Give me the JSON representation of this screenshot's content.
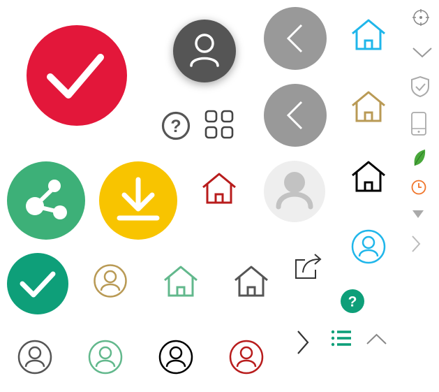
{
  "colors": {
    "red": "#e3173a",
    "dark_gray": "#555555",
    "mid_gray": "#999999",
    "light_gray": "#eeeeee",
    "cyan": "#1fb6ea",
    "gold": "#b99a55",
    "black": "#000000",
    "green": "#3db078",
    "teal": "#0e9f79",
    "yellow": "#f8c400",
    "dark_red": "#b81c1c",
    "pale_green": "#62b88c",
    "orange": "#f0752a",
    "leaf_green": "#49a83b"
  },
  "icons": [
    "check-circle-red",
    "user-circle-dark",
    "back-circle-gray",
    "home-cyan",
    "target",
    "chevron-down",
    "shield-check",
    "phone",
    "leaf",
    "clock",
    "caret-down",
    "chevron-right-light",
    "help-circle",
    "grid",
    "back-circle-gray",
    "home-gold",
    "share-circle-green",
    "download-circle-yellow",
    "home-red",
    "user-placeholder",
    "home-black",
    "user-cyan",
    "check-circle-teal",
    "user-gold",
    "home-green",
    "home-gray",
    "share-external",
    "help-badge-teal",
    "user-gray",
    "user-green",
    "user-black",
    "user-red",
    "chevron-right-dark",
    "list-teal",
    "chevron-up"
  ],
  "help_badge": {
    "symbol": "?"
  },
  "help_outline": {
    "symbol": "?"
  }
}
